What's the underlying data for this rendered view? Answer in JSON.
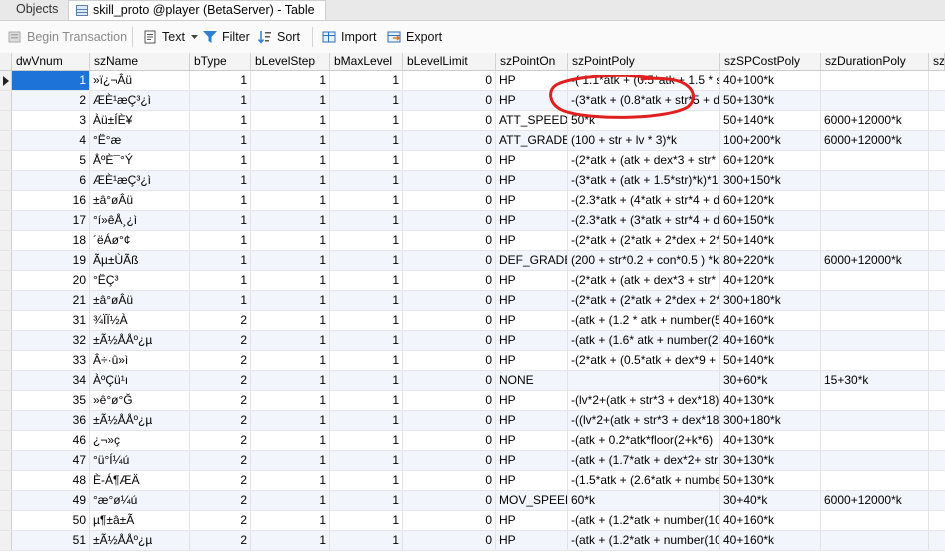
{
  "tabs": [
    {
      "label": "Objects",
      "icon": "objects-tab",
      "active": false
    },
    {
      "label": "skill_proto @player (BetaServer) - Table",
      "icon": "table-icon",
      "active": true
    }
  ],
  "toolbar": {
    "begin_transaction": "Begin Transaction",
    "text": "Text",
    "filter": "Filter",
    "sort": "Sort",
    "import": "Import",
    "export": "Export"
  },
  "columns": [
    "dwVnum",
    "szName",
    "bType",
    "bLevelStep",
    "bMaxLevel",
    "bLevelLimit",
    "szPointOn",
    "szPointPoly",
    "szSPCostPoly",
    "szDurationPoly",
    "sz"
  ],
  "rows": [
    [
      "1",
      "»ï¿¬Âü",
      "1",
      "1",
      "1",
      "0",
      "HP",
      "-( 1.1*atk + (0.5*atk +  1.5 * s",
      "40+100*k",
      ""
    ],
    [
      "2",
      "ÆÈ¹æÇ³¿ì",
      "1",
      "1",
      "1",
      "0",
      "HP",
      "-(3*atk + (0.8*atk + str*5 + d",
      "50+130*k",
      ""
    ],
    [
      "3",
      "Àü±ÍÈ¥",
      "1",
      "1",
      "1",
      "0",
      "ATT_SPEED",
      "50*k",
      "50+140*k",
      "6000+12000*k"
    ],
    [
      "4",
      "°Ë°æ",
      "1",
      "1",
      "1",
      "0",
      "ATT_GRADE",
      "(100 + str + lv * 3)*k",
      "100+200*k",
      "6000+12000*k"
    ],
    [
      "5",
      "ÅºÈ¯°Ý",
      "1",
      "1",
      "1",
      "0",
      "HP",
      "-(2*atk + (atk + dex*3 + str*",
      "60+120*k",
      ""
    ],
    [
      "6",
      "ÆÈ¹æÇ³¿ì",
      "1",
      "1",
      "1",
      "0",
      "HP",
      "-(3*atk + (atk + 1.5*str)*k)*1",
      "300+150*k",
      ""
    ],
    [
      "16",
      "±â°øÂü",
      "1",
      "1",
      "1",
      "0",
      "HP",
      "-(2.3*atk + (4*atk  + str*4 + d",
      "60+120*k",
      ""
    ],
    [
      "17",
      "°í»êÅ¸¿ì",
      "1",
      "1",
      "1",
      "0",
      "HP",
      "-(2.3*atk + (3*atk + str*4 + d",
      "60+150*k",
      ""
    ],
    [
      "18",
      "´ëÁø°¢",
      "1",
      "1",
      "1",
      "0",
      "HP",
      "-(2*atk + (2*atk + 2*dex + 2*",
      "50+140*k",
      ""
    ],
    [
      "19",
      "Ãµ±ÙÃß",
      "1",
      "1",
      "1",
      "0",
      "DEF_GRADE",
      "(200 + str*0.2 + con*0.5 ) *k",
      "80+220*k",
      "6000+12000*k"
    ],
    [
      "20",
      "°ËÇ³",
      "1",
      "1",
      "1",
      "0",
      "HP",
      "-(2*atk + (atk + dex*3 + str*",
      "40+120*k",
      ""
    ],
    [
      "21",
      "±â°øÂü",
      "1",
      "1",
      "1",
      "0",
      "HP",
      "-(2*atk + (2*atk + 2*dex + 2*",
      "300+180*k",
      ""
    ],
    [
      "31",
      "¾ÏÏ½À",
      "2",
      "1",
      "1",
      "0",
      "HP",
      "-(atk + (1.2 * atk + number(5",
      "40+160*k",
      ""
    ],
    [
      "32",
      "±Ã½ÅÅº¿µ",
      "2",
      "1",
      "1",
      "0",
      "HP",
      "-(atk + (1.6* atk + number(2",
      "40+160*k",
      ""
    ],
    [
      "33",
      "Â÷·û»ì",
      "2",
      "1",
      "1",
      "0",
      "HP",
      "-(2*atk + (0.5*atk + dex*9 +",
      "50+140*k",
      ""
    ],
    [
      "34",
      "ÀºÇü¹ı",
      "2",
      "1",
      "1",
      "0",
      "NONE",
      "",
      "30+60*k",
      "15+30*k"
    ],
    [
      "35",
      "»ê°ø°Ğ",
      "2",
      "1",
      "1",
      "0",
      "HP",
      "-(lv*2+(atk + str*3 + dex*18)",
      "40+130*k",
      ""
    ],
    [
      "36",
      "±Ã½ÅÅº¿µ",
      "2",
      "1",
      "1",
      "0",
      "HP",
      "-((lv*2+(atk + str*3 + dex*18",
      "300+180*k",
      ""
    ],
    [
      "46",
      "¿¬»ç",
      "2",
      "1",
      "1",
      "0",
      "HP",
      "-(atk + 0.2*atk*floor(2+k*6)",
      "40+130*k",
      ""
    ],
    [
      "47",
      "°ü°Í¼ú",
      "2",
      "1",
      "1",
      "0",
      "HP",
      "-(atk + (1.7*atk + dex*2+ str",
      "30+130*k",
      ""
    ],
    [
      "48",
      "È-Á¶ÆÄ",
      "2",
      "1",
      "1",
      "0",
      "HP",
      "-(1.5*atk + (2.6*atk + numbe",
      "50+130*k",
      ""
    ],
    [
      "49",
      "°æ°ø¼ú",
      "2",
      "1",
      "1",
      "0",
      "MOV_SPEED",
      "60*k",
      "30+40*k",
      "6000+12000*k"
    ],
    [
      "50",
      "µ¶±â±Ã",
      "2",
      "1",
      "1",
      "0",
      "HP",
      "-(atk + (1.2*atk + number(10",
      "40+160*k",
      ""
    ],
    [
      "51",
      "±Ã½ÅÅº¿µ",
      "2",
      "1",
      "1",
      "0",
      "HP",
      "-(atk + (1.2*atk + number(10",
      "40+160*k",
      ""
    ]
  ],
  "colors": {
    "selection": "#1e73d9",
    "annotation": "#e0201e",
    "row_alt": "#f2f5fb"
  }
}
